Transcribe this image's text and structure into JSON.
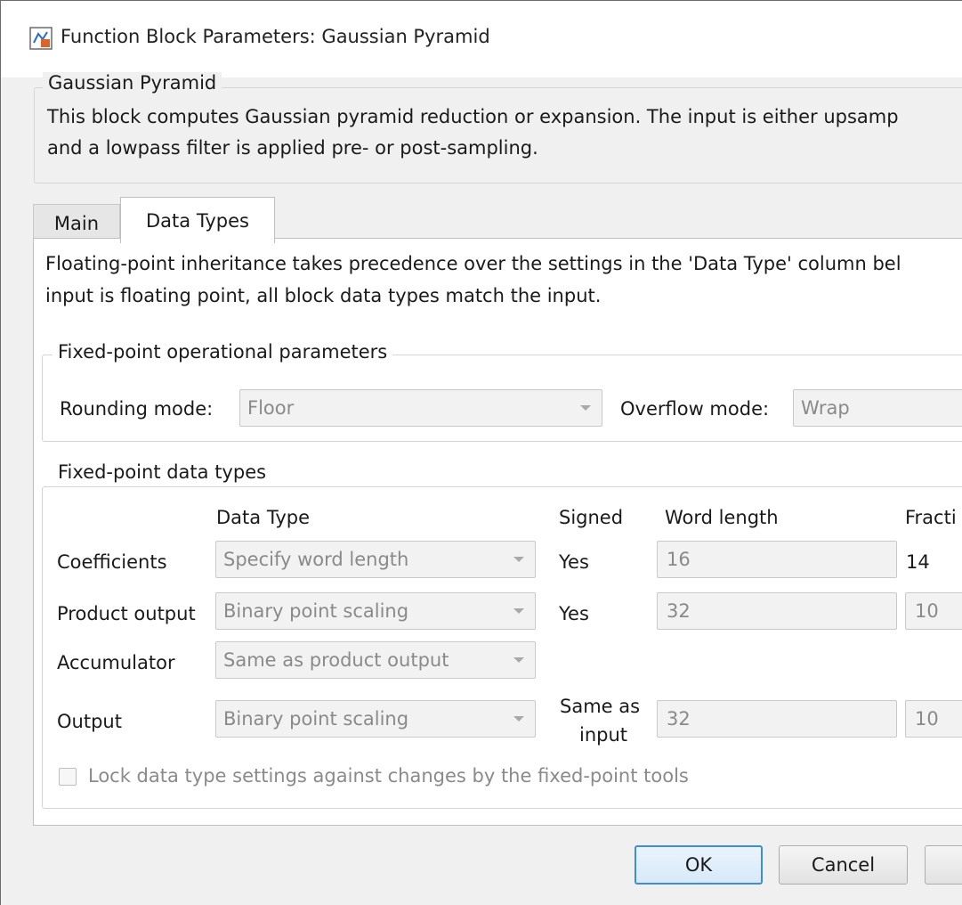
{
  "window": {
    "title": "Function Block Parameters: Gaussian Pyramid"
  },
  "block": {
    "group_title": "Gaussian Pyramid",
    "description_line1": "This block computes Gaussian pyramid reduction or expansion.  The input is either upsamp",
    "description_line2": "and a lowpass filter is applied pre- or post-sampling."
  },
  "tabs": [
    {
      "label": "Main",
      "selected": false
    },
    {
      "label": "Data Types",
      "selected": true
    }
  ],
  "data_types": {
    "note_line1": "Floating-point inheritance takes precedence over the settings in the 'Data Type' column bel",
    "note_line2": "input is floating point, all block data types match the input.",
    "operational": {
      "title": "Fixed-point operational parameters",
      "rounding_label": "Rounding mode:",
      "rounding_value": "Floor",
      "overflow_label": "Overflow mode:",
      "overflow_value": "Wrap"
    },
    "types": {
      "title": "Fixed-point data types",
      "headers": {
        "data_type": "Data Type",
        "signed": "Signed",
        "word_length": "Word length",
        "fraction": "Fracti"
      },
      "rows": [
        {
          "label": "Coefficients",
          "data_type": "Specify word length",
          "signed": "Yes",
          "word_length": "16",
          "fraction": "14"
        },
        {
          "label": "Product output",
          "data_type": "Binary point scaling",
          "signed": "Yes",
          "word_length": "32",
          "fraction": "10"
        },
        {
          "label": "Accumulator",
          "data_type": "Same as product output"
        },
        {
          "label": "Output",
          "data_type": "Binary point scaling",
          "signed_line1": "Same as",
          "signed_line2": "input",
          "word_length": "32",
          "fraction": "10"
        }
      ],
      "lock_label": "Lock data type settings against changes by the fixed-point tools",
      "lock_checked": false
    }
  },
  "buttons": {
    "ok": "OK",
    "cancel": "Cancel"
  }
}
